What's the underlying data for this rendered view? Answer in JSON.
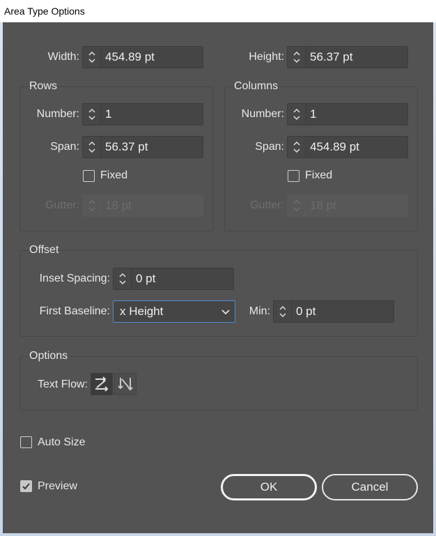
{
  "window": {
    "title": "Area Type Options"
  },
  "size": {
    "width_label": "Width:",
    "width_value": "454.89 pt",
    "height_label": "Height:",
    "height_value": "56.37 pt"
  },
  "rows": {
    "title": "Rows",
    "number_label": "Number:",
    "number_value": "1",
    "span_label": "Span:",
    "span_value": "56.37 pt",
    "fixed_label": "Fixed",
    "fixed_checked": false,
    "gutter_label": "Gutter:",
    "gutter_value": "18 pt"
  },
  "columns": {
    "title": "Columns",
    "number_label": "Number:",
    "number_value": "1",
    "span_label": "Span:",
    "span_value": "454.89 pt",
    "fixed_label": "Fixed",
    "fixed_checked": false,
    "gutter_label": "Gutter:",
    "gutter_value": "18 pt"
  },
  "offset": {
    "title": "Offset",
    "inset_label": "Inset Spacing:",
    "inset_value": "0 pt",
    "baseline_label": "First Baseline:",
    "baseline_value": "x Height",
    "min_label": "Min:",
    "min_value": "0 pt"
  },
  "options": {
    "title": "Options",
    "text_flow_label": "Text Flow:",
    "text_flow_icons": [
      "flow-by-rows-icon",
      "flow-by-columns-icon"
    ]
  },
  "auto_size": {
    "label": "Auto Size",
    "checked": false
  },
  "preview": {
    "label": "Preview",
    "checked": true
  },
  "buttons": {
    "ok": "OK",
    "cancel": "Cancel"
  },
  "colors": {
    "dialog_bg": "#535353",
    "field_bg": "#454545",
    "focus": "#4e8ed6",
    "text": "#e8e8e8"
  }
}
